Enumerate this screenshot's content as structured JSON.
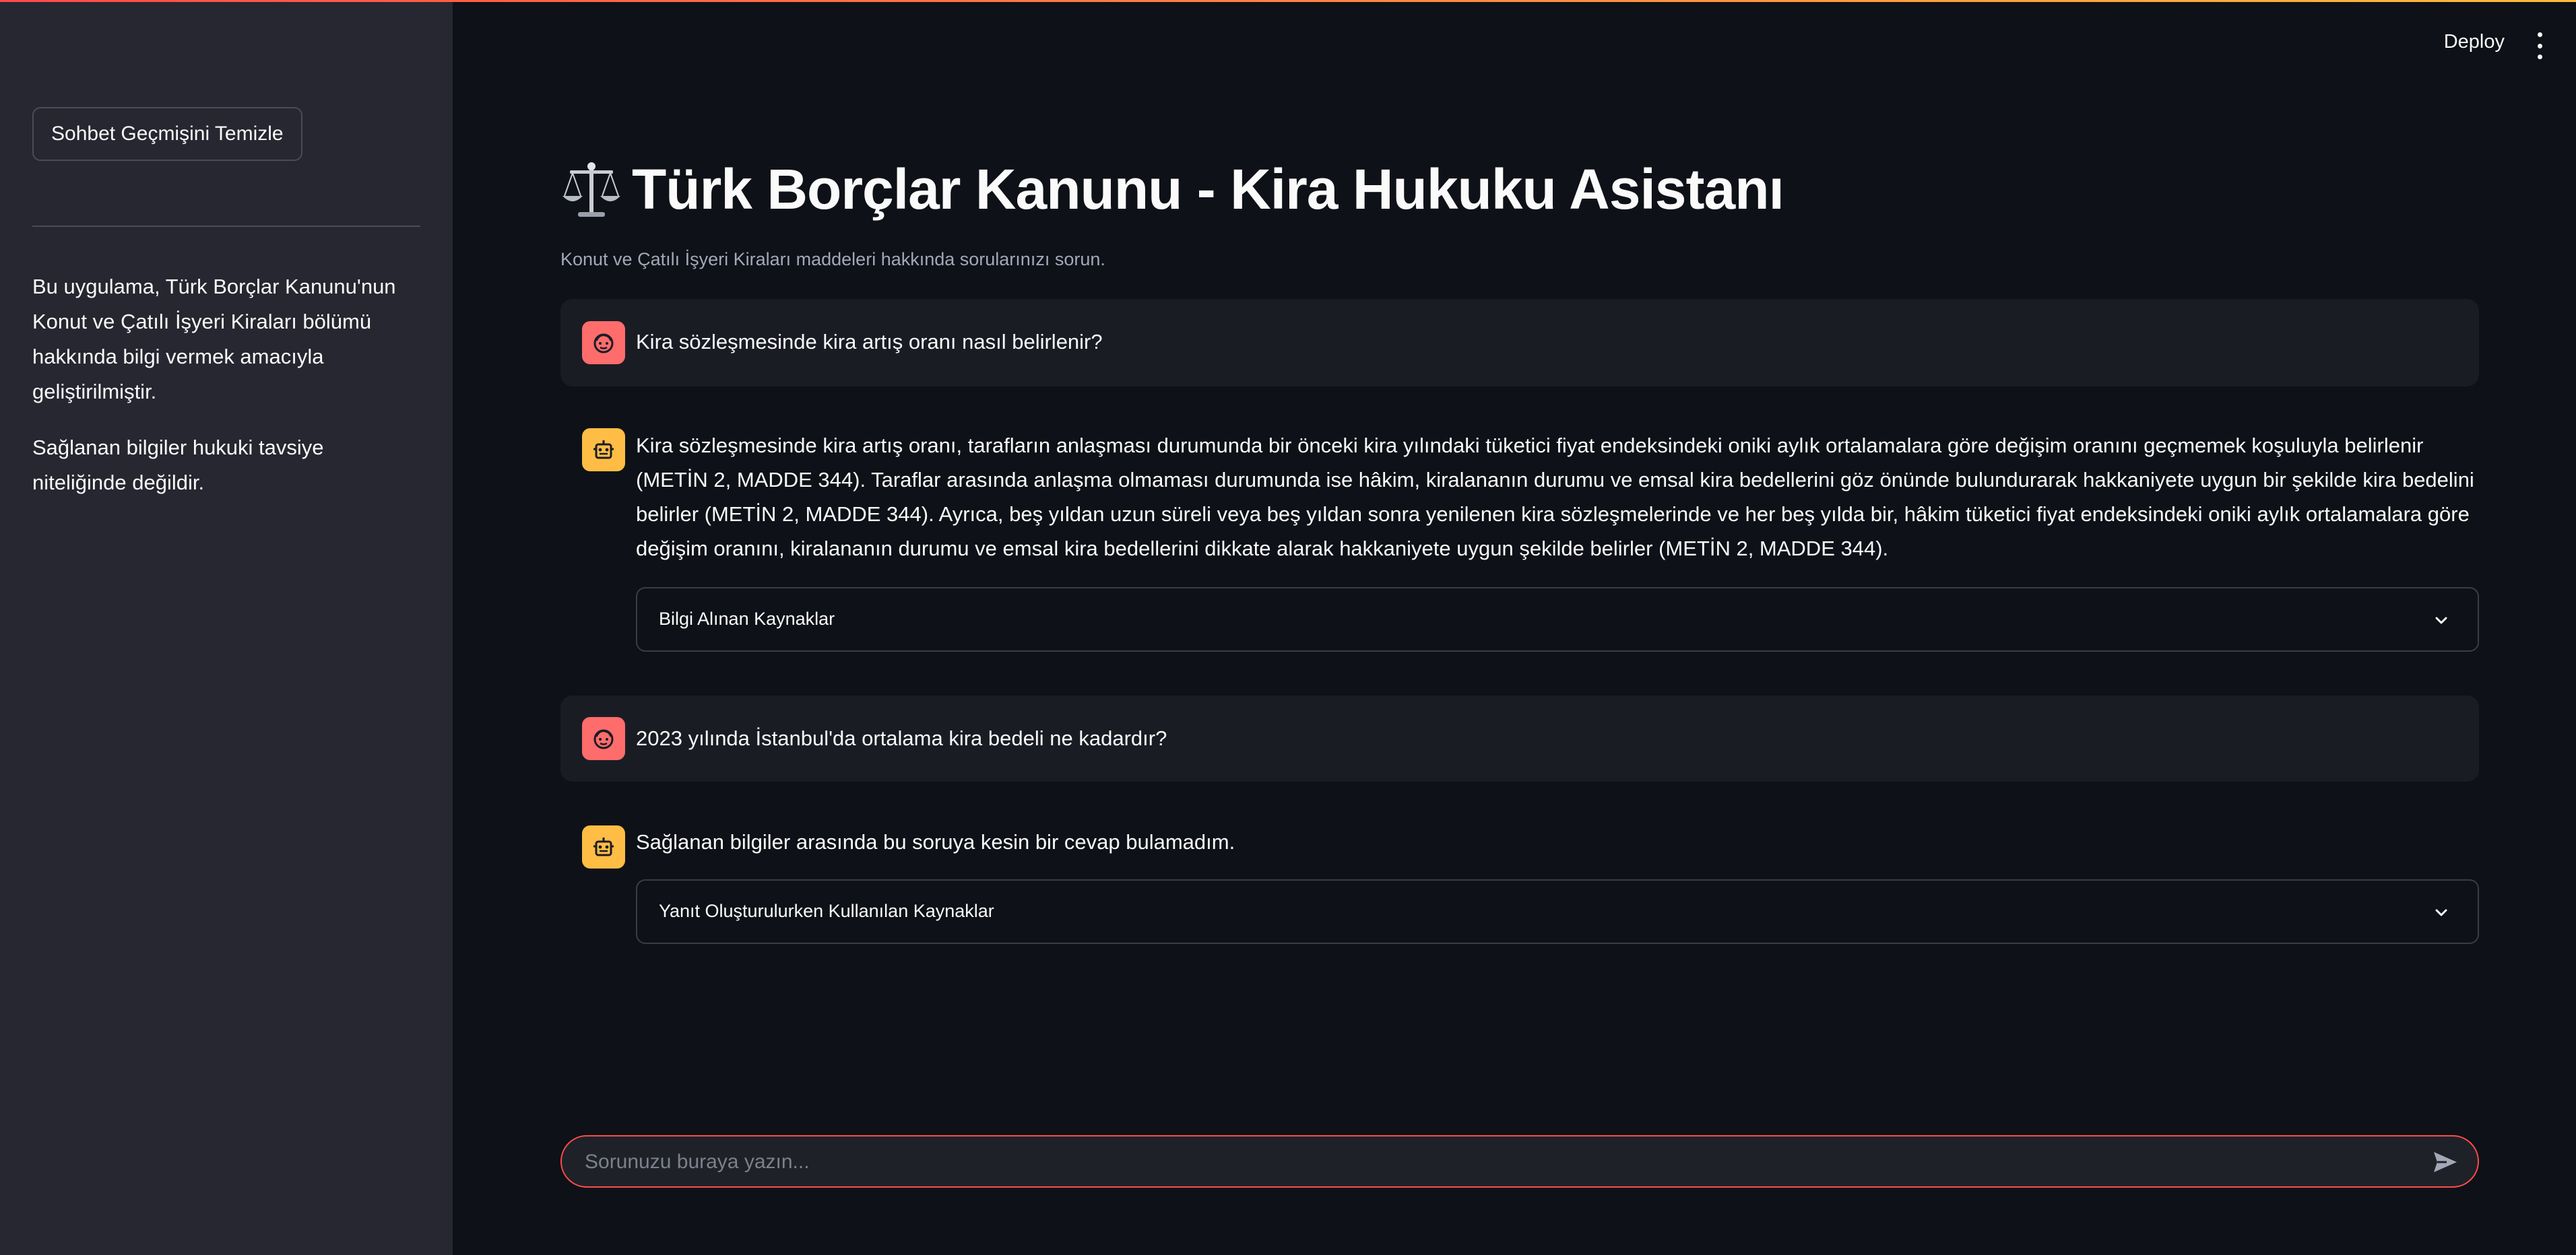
{
  "app": {
    "title": "Türk Borçlar Kanunu - Kira Hukuku Asistanı",
    "subtitle": "Konut ve Çatılı İşyeri Kiraları maddeleri hakkında sorularınızı sorun.",
    "title_icon": "balance-scale-icon"
  },
  "header": {
    "deploy_label": "Deploy",
    "menu_icon": "kebab-menu-icon"
  },
  "sidebar": {
    "clear_button_label": "Sohbet Geçmişini Temizle",
    "info_paragraph_1": "Bu uygulama, Türk Borçlar Kanunu'nun Konut ve Çatılı İşyeri Kiraları bölümü hakkında bilgi vermek amacıyla geliştirilmiştir.",
    "info_paragraph_2": "Sağlanan bilgiler hukuki tavsiye niteliğinde değildir."
  },
  "messages": [
    {
      "role": "user",
      "text": "Kira sözleşmesinde kira artış oranı nasıl belirlenir?"
    },
    {
      "role": "assistant",
      "text": "Kira sözleşmesinde kira artış oranı, tarafların anlaşması durumunda bir önceki kira yılındaki tüketici fiyat endeksindeki oniki aylık ortalamalara göre değişim oranını geçmemek koşuluyla belirlenir (METİN 2, MADDE 344). Taraflar arasında anlaşma olmaması durumunda ise hâkim, kiralananın durumu ve emsal kira bedellerini göz önünde bulundurarak hakkaniyete uygun bir şekilde kira bedelini belirler (METİN 2, MADDE 344). Ayrıca, beş yıldan uzun süreli veya beş yıldan sonra yenilenen kira sözleşmelerinde ve her beş yılda bir, hâkim tüketici fiyat endeksindeki oniki aylık ortalamalara göre değişim oranını, kiralananın durumu ve emsal kira bedellerini dikkate alarak hakkaniyete uygun şekilde belirler (METİN 2, MADDE 344).",
      "expander_label": "Bilgi Alınan Kaynaklar"
    },
    {
      "role": "user",
      "text": "2023 yılında İstanbul'da ortalama kira bedeli ne kadardır?"
    },
    {
      "role": "assistant",
      "text": "Sağlanan bilgiler arasında bu soruya kesin bir cevap bulamadım.",
      "expander_label": "Yanıt Oluşturulurken Kullanılan Kaynaklar"
    }
  ],
  "chat_input": {
    "placeholder": "Sorunuzu buraya yazın...",
    "value": "",
    "send_icon": "send-icon"
  },
  "colors": {
    "background": "#0e1117",
    "sidebar": "#262730",
    "user_message_bg": "#1a1c24",
    "user_avatar": "#ff6c6c",
    "assistant_avatar": "#ffbd45",
    "input_border_focus": "#ff4b4b"
  }
}
